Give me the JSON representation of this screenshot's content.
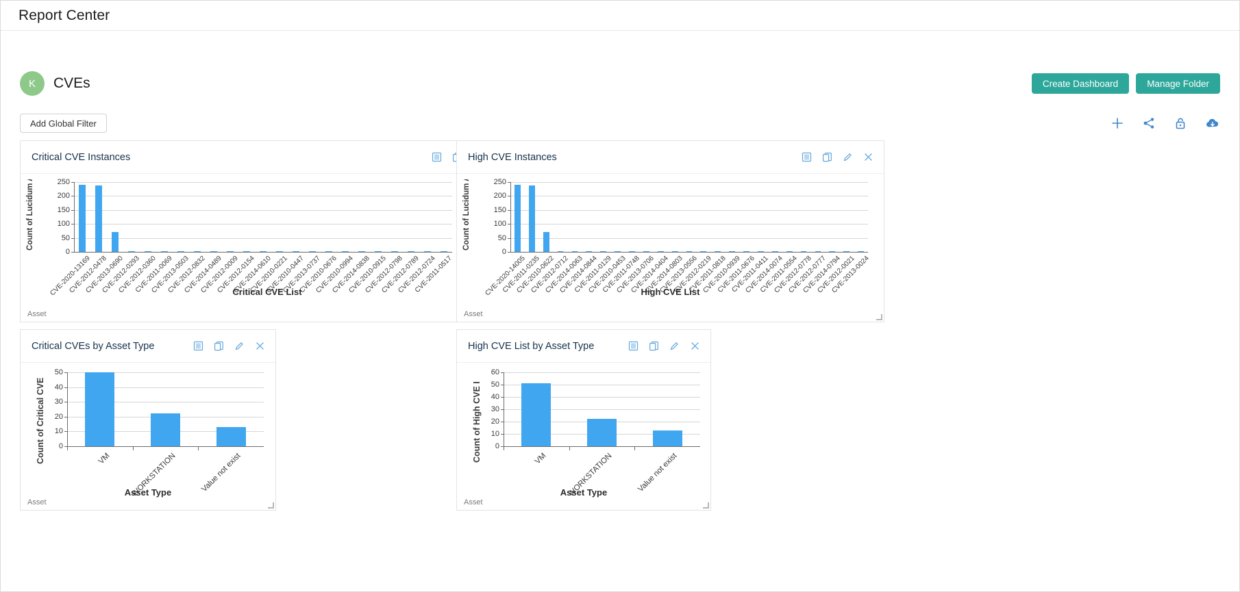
{
  "app": {
    "title": "Report Center"
  },
  "folder": {
    "avatar_initial": "K",
    "name": "CVEs",
    "create_dashboard_label": "Create Dashboard",
    "manage_folder_label": "Manage Folder"
  },
  "filters": {
    "add_global_filter_label": "Add Global Filter"
  },
  "toolbar_icons": [
    {
      "name": "add-icon",
      "glyph": "plus"
    },
    {
      "name": "share-icon",
      "glyph": "share"
    },
    {
      "name": "unlock-icon",
      "glyph": "unlock"
    },
    {
      "name": "cloud-download-icon",
      "glyph": "cloud-download"
    }
  ],
  "panel_icons": [
    {
      "name": "table-view-icon"
    },
    {
      "name": "duplicate-icon"
    },
    {
      "name": "edit-icon"
    },
    {
      "name": "close-icon"
    }
  ],
  "colors": {
    "accent_teal": "#2ea79b",
    "icon_blue": "#3f86cc",
    "bar_blue": "#41a6f0",
    "avatar_green": "#8ec98a"
  },
  "panels": [
    {
      "id": "critical-cve-instances",
      "title": "Critical CVE Instances",
      "footer": "Asset"
    },
    {
      "id": "high-cve-instances",
      "title": "High CVE Instances",
      "footer": "Asset"
    },
    {
      "id": "critical-cves-by-asset-type",
      "title": "Critical CVEs by Asset Type",
      "footer": "Asset"
    },
    {
      "id": "high-cve-list-by-asset-type",
      "title": "High CVE List by Asset Type",
      "footer": "Asset"
    }
  ],
  "chart_data": [
    {
      "id": "critical-cve-instances",
      "type": "bar",
      "title": "Critical CVE Instances",
      "xlabel": "Critical CVE List",
      "ylabel": "Count of Lucidum Asse",
      "ylim": [
        0,
        250
      ],
      "yticks": [
        0,
        50,
        100,
        150,
        200,
        250
      ],
      "grid": true,
      "categories": [
        "CVE-2020-13169",
        "CVE-2012-0478",
        "CVE-2013-0690",
        "CVE-2012-0293",
        "CVE-2012-0360",
        "CVE-2011-0069",
        "CVE-2013-0503",
        "CVE-2012-0832",
        "CVE-2014-0489",
        "CVE-2012-0009",
        "CVE-2012-0154",
        "CVE-2014-0610",
        "CVE-2010-0221",
        "CVE-2010-0447",
        "CVE-2013-0737",
        "CVE-2010-0676",
        "CVE-2010-0994",
        "CVE-2014-0838",
        "CVE-2010-0915",
        "CVE-2012-0798",
        "CVE-2012-0789",
        "CVE-2012-0724",
        "CVE-2011-0517"
      ],
      "values": [
        240,
        238,
        70,
        2,
        2,
        2,
        2,
        1,
        1,
        1,
        1,
        1,
        1,
        1,
        1,
        1,
        1,
        1,
        1,
        1,
        1,
        1,
        1
      ]
    },
    {
      "id": "high-cve-instances",
      "type": "bar",
      "title": "High CVE Instances",
      "xlabel": "High CVE List",
      "ylabel": "Count of Lucidum Asse",
      "ylim": [
        0,
        250
      ],
      "yticks": [
        0,
        50,
        100,
        150,
        200,
        250
      ],
      "grid": true,
      "categories": [
        "CVE-2020-14005",
        "CVE-2011-0235",
        "CVE-2010-0622",
        "CVE-2012-0712",
        "CVE-2014-0063",
        "CVE-2014-0844",
        "CVE-2011-0129",
        "CVE-2010-0453",
        "CVE-2011-0748",
        "CVE-2013-0706",
        "CVE-2014-0404",
        "CVE-2014-0803",
        "CVE-2013-0556",
        "CVE-2012-0219",
        "CVE-2011-0818",
        "CVE-2010-0939",
        "CVE-2011-0676",
        "CVE-2011-0411",
        "CVE-2014-0074",
        "CVE-2011-0554",
        "CVE-2012-0778",
        "CVE-2012-0777",
        "CVE-2014-0794",
        "CVE-2012-0021",
        "CVE-2013-0024"
      ],
      "values": [
        240,
        238,
        70,
        2,
        2,
        2,
        2,
        1,
        1,
        1,
        1,
        1,
        1,
        1,
        1,
        1,
        1,
        1,
        1,
        1,
        1,
        1,
        1,
        1,
        1
      ]
    },
    {
      "id": "critical-cves-by-asset-type",
      "type": "bar",
      "title": "Critical CVEs by Asset Type",
      "xlabel": "Asset Type",
      "ylabel": "Count of Critical CVE",
      "ylim": [
        0,
        50
      ],
      "yticks": [
        0,
        10,
        20,
        30,
        40,
        50
      ],
      "grid": true,
      "categories": [
        "VM",
        "WORKSTATION",
        "Value not exist"
      ],
      "values": [
        50,
        22,
        13
      ]
    },
    {
      "id": "high-cve-list-by-asset-type",
      "type": "bar",
      "title": "High CVE List by Asset Type",
      "xlabel": "Asset Type",
      "ylabel": "Count of High CVE I",
      "ylim": [
        0,
        60
      ],
      "yticks": [
        0,
        10,
        20,
        30,
        40,
        50,
        60
      ],
      "grid": true,
      "categories": [
        "VM",
        "WORKSTATION",
        "Value not exist"
      ],
      "values": [
        51,
        22,
        13
      ]
    }
  ]
}
